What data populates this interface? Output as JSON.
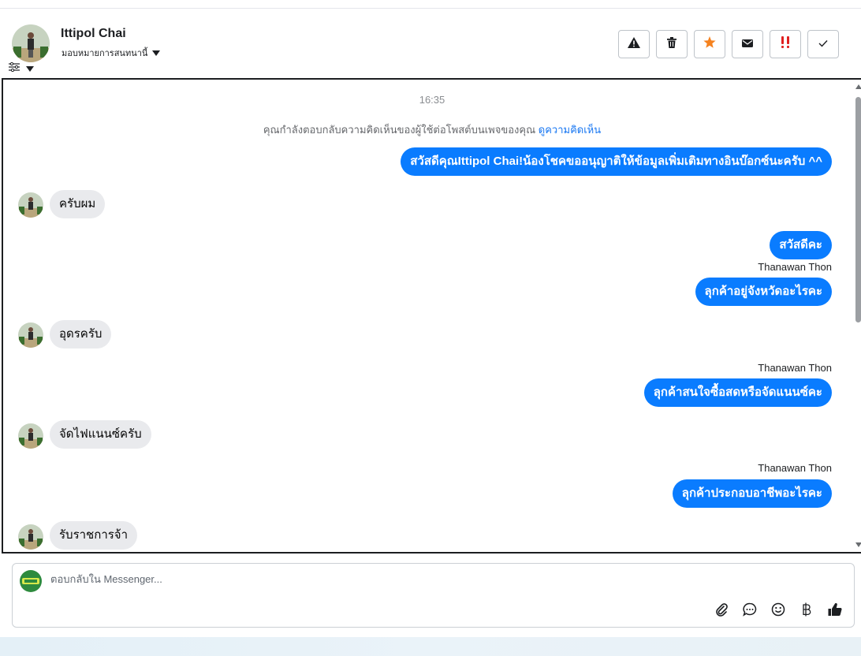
{
  "header": {
    "customer_name": "Ittipol Chai",
    "assign_label": "มอบหมายการสนทนานี้",
    "actions": [
      {
        "name": "report-button",
        "icon": "warning-icon"
      },
      {
        "name": "delete-button",
        "icon": "trash-icon"
      },
      {
        "name": "star-button",
        "icon": "star-icon"
      },
      {
        "name": "mark-unread-button",
        "icon": "envelope-icon"
      },
      {
        "name": "mark-urgent-button",
        "icon": "double-exclamation-icon"
      },
      {
        "name": "mark-done-button",
        "icon": "checkmark-icon"
      }
    ]
  },
  "chat": {
    "timestamp": "16:35",
    "notice_text": "คุณกำลังตอบกลับความคิดเห็นของผู้ใช้ต่อโพสต์บนเพจของคุณ",
    "notice_link": "ดูความคิดเห็น",
    "messages": [
      {
        "direction": "out",
        "text": "สวัสดีคุณIttipol Chai!น้องโชคขออนุญาติให้ข้อมูลเพิ่มเติมทางอินบ๊อกซ์นะครับ ^^"
      },
      {
        "direction": "in",
        "text": "ครับผม"
      },
      {
        "direction": "out",
        "text": "สวัสดีคะ"
      },
      {
        "direction": "out",
        "sender": "Thanawan Thon",
        "text": "ลุกค้าอยู่จังหวัดอะไรคะ"
      },
      {
        "direction": "in",
        "text": "อุดรครับ"
      },
      {
        "direction": "out",
        "sender": "Thanawan Thon",
        "text": "ลุกค้าสนใจซื้อสดหรือจัดแนนซ์คะ"
      },
      {
        "direction": "in",
        "text": "จัดไฟแนนซ์ครับ"
      },
      {
        "direction": "out",
        "sender": "Thanawan Thon",
        "text": "ลุกค้าประกอบอาชีพอะไรคะ"
      },
      {
        "direction": "in",
        "text": "รับราชการจ้า"
      }
    ]
  },
  "composer": {
    "placeholder": "ตอบกลับใน Messenger...",
    "tools": [
      "attach-icon",
      "chat-bubble-icon",
      "emoji-icon",
      "baht-icon",
      "thumbs-up-icon"
    ]
  },
  "colors": {
    "outgoing_bubble": "#0a7cff",
    "incoming_bubble": "#e9eaed",
    "link": "#1877f2",
    "star": "#f5821f",
    "urgent": "#e02020"
  }
}
